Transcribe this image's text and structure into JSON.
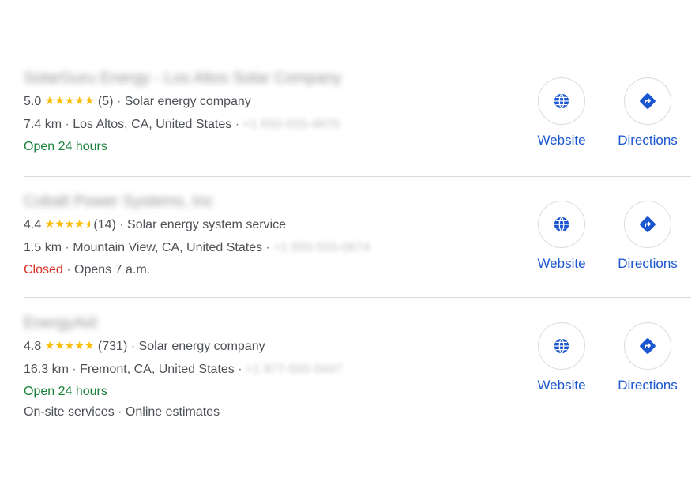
{
  "listings": [
    {
      "name": "SolarGuru Energy - Los Altos Solar Company",
      "rating": "5.0",
      "stars": "★★★★★",
      "reviews": "(5)",
      "category": "Solar energy company",
      "distance": "7.4 km",
      "address": "Los Altos, CA, United States",
      "phone": "+1 650-555-4870",
      "status": "Open 24 hours",
      "status_color": "#188038",
      "extra": "",
      "website_label": "Website",
      "directions_label": "Directions"
    },
    {
      "name": "Cobalt Power Systems, Inc",
      "rating": "4.4",
      "stars": "★★★★",
      "reviews": "(14)",
      "category": "Solar energy system service",
      "distance": "1.5 km",
      "address": "Mountain View, CA, United States",
      "phone": "+1 650-555-0674",
      "status": "Closed",
      "status_color": "#d93025",
      "status_detail": "Opens 7 a.m.",
      "extra": "",
      "website_label": "Website",
      "directions_label": "Directions"
    },
    {
      "name": "EnergyAid",
      "rating": "4.8",
      "stars": "★★★★★",
      "reviews": "(731)",
      "category": "Solar energy company",
      "distance": "16.3 km",
      "address": "Fremont, CA, United States",
      "phone": "+1 877-555-0447",
      "status": "Open 24 hours",
      "status_color": "#188038",
      "extra": "On-site services · Online estimates",
      "website_label": "Website",
      "directions_label": "Directions"
    }
  ],
  "separator": "·",
  "icons": {
    "website": "globe-icon",
    "directions": "directions-icon"
  },
  "colors": {
    "accent": "#1a56cf",
    "star": "#fbbc04",
    "open": "#188038",
    "closed": "#d93025"
  }
}
